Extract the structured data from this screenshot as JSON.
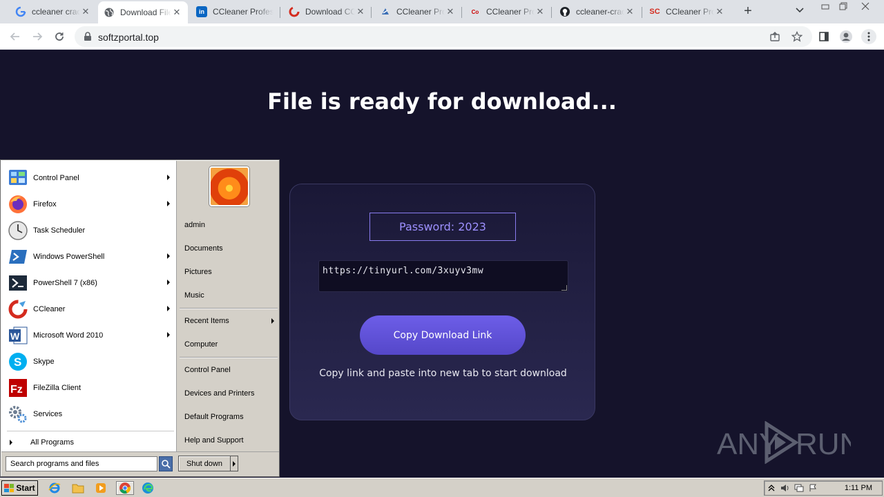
{
  "browser": {
    "tabs": [
      {
        "title": "ccleaner crack",
        "favicon": "google-icon"
      },
      {
        "title": "Download File",
        "favicon": "globe-icon",
        "active": true
      },
      {
        "title": "CCleaner Professional",
        "favicon": "linkedin-icon"
      },
      {
        "title": "Download CCleaner",
        "favicon": "ccleaner-icon"
      },
      {
        "title": "CCleaner Professional",
        "favicon": "crack-site-icon"
      },
      {
        "title": "CCleaner Pro",
        "favicon": "cowp-icon"
      },
      {
        "title": "ccleaner-crack",
        "favicon": "github-icon"
      },
      {
        "title": "CCleaner Pro",
        "favicon": "sc-icon"
      }
    ],
    "url": "softzportal.top"
  },
  "page": {
    "heading": "File is ready for download...",
    "password_label": "Password: 2023",
    "download_link": "https://tinyurl.com/3xuyv3mw",
    "copy_button": "Copy Download Link",
    "hint": "Copy link and paste into new tab to start download"
  },
  "watermark": {
    "text_left": "ANY",
    "text_right": "RUN"
  },
  "start_menu": {
    "programs": [
      {
        "label": "Control Panel",
        "icon": "control-panel-icon",
        "submenu": true
      },
      {
        "label": "Firefox",
        "icon": "firefox-icon",
        "submenu": true
      },
      {
        "label": "Task Scheduler",
        "icon": "clock-icon",
        "submenu": false
      },
      {
        "label": "Windows PowerShell",
        "icon": "powershell-icon",
        "submenu": true
      },
      {
        "label": "PowerShell 7 (x86)",
        "icon": "powershell7-icon",
        "submenu": true
      },
      {
        "label": "CCleaner",
        "icon": "ccleaner-icon",
        "submenu": true
      },
      {
        "label": "Microsoft Word 2010",
        "icon": "word-icon",
        "submenu": true
      },
      {
        "label": "Skype",
        "icon": "skype-icon",
        "submenu": false
      },
      {
        "label": "FileZilla Client",
        "icon": "filezilla-icon",
        "submenu": false
      },
      {
        "label": "Services",
        "icon": "gears-icon",
        "submenu": false
      }
    ],
    "all_programs": "All Programs",
    "right": {
      "user": "admin",
      "group1": [
        "Documents",
        "Pictures",
        "Music"
      ],
      "recent_items": "Recent Items",
      "computer": "Computer",
      "group2": [
        "Control Panel",
        "Devices and Printers",
        "Default Programs",
        "Help and Support"
      ]
    },
    "search_placeholder": "Search programs and files",
    "shutdown": "Shut down"
  },
  "taskbar": {
    "start": "Start",
    "clock": "1:11 PM"
  },
  "colors": {
    "page_bg": "#15132b",
    "accent": "#6d5ee8",
    "password_text": "#9d90ff"
  }
}
